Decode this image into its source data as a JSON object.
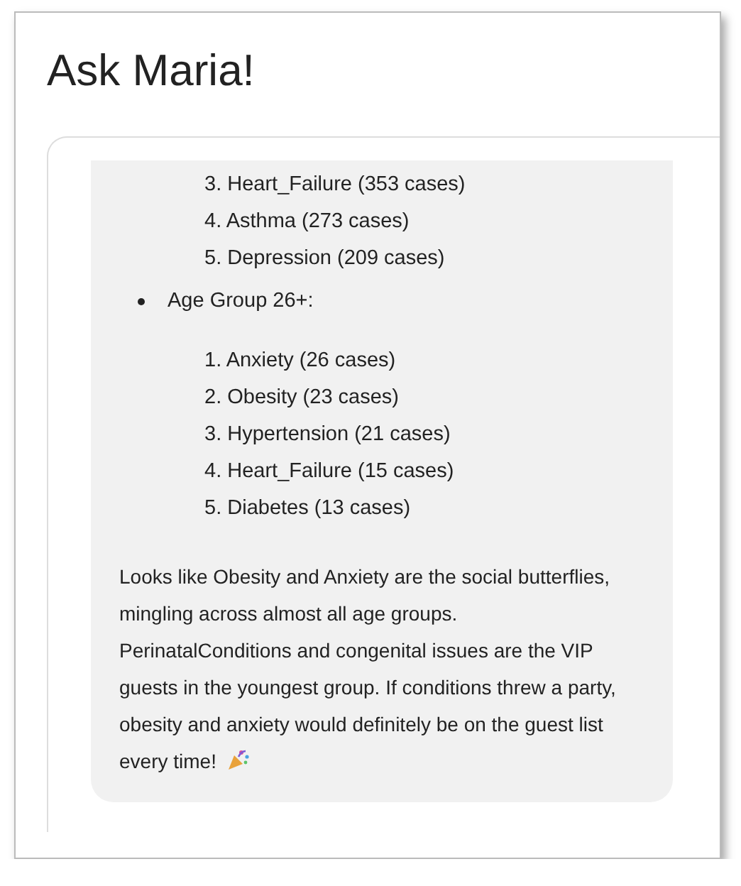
{
  "title": "Ask Maria!",
  "message": {
    "lists": [
      {
        "items": [
          "3. Heart_Failure (353 cases)",
          "4. Asthma (273 cases)",
          "5. Depression (209 cases)"
        ]
      },
      {
        "heading": "Age Group 26+:",
        "items": [
          "1. Anxiety (26 cases)",
          "2. Obesity (23 cases)",
          "3. Hypertension (21 cases)",
          "4. Heart_Failure (15 cases)",
          "5. Diabetes (13 cases)"
        ]
      }
    ],
    "paragraph": "Looks like Obesity and Anxiety are the social butterflies, mingling across almost all age groups. PerinatalConditions and congenital issues are the VIP guests in the youngest group. If conditions threw a party, obesity and anxiety would definitely be on the guest list every time!"
  }
}
